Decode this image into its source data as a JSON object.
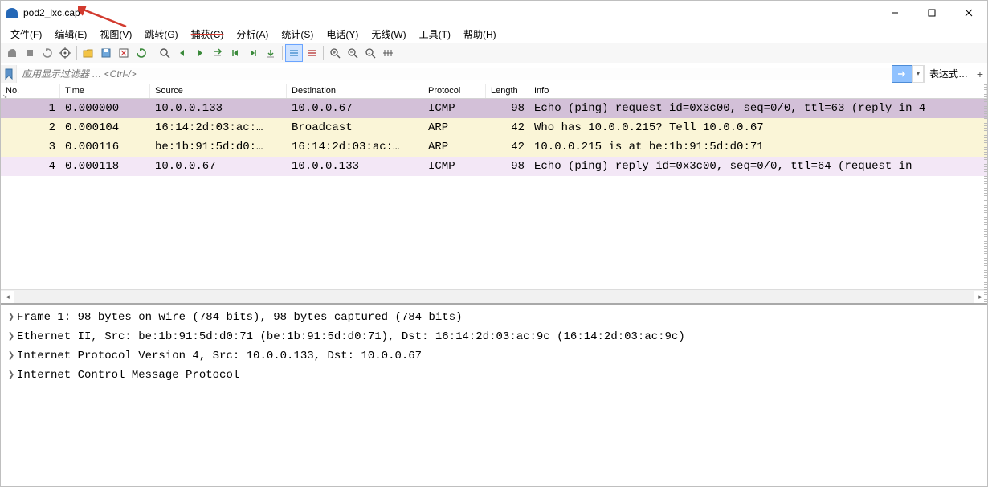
{
  "window": {
    "title": "pod2_lxc.cap"
  },
  "menu": {
    "items": [
      {
        "label": "文件(F)"
      },
      {
        "label": "编辑(E)"
      },
      {
        "label": "视图(V)"
      },
      {
        "label": "跳转(G)"
      },
      {
        "label": "捕获(C)",
        "strike": true
      },
      {
        "label": "分析(A)"
      },
      {
        "label": "统计(S)"
      },
      {
        "label": "电话(Y)"
      },
      {
        "label": "无线(W)"
      },
      {
        "label": "工具(T)"
      },
      {
        "label": "帮助(H)"
      }
    ]
  },
  "filter": {
    "placeholder": "应用显示过滤器 … <Ctrl-/>",
    "expression": "表达式…"
  },
  "columns": {
    "no": "No.",
    "time": "Time",
    "source": "Source",
    "destination": "Destination",
    "protocol": "Protocol",
    "length": "Length",
    "info": "Info"
  },
  "packets": [
    {
      "no": "1",
      "time": "0.000000",
      "source": "10.0.0.133",
      "destination": "10.0.0.67",
      "protocol": "ICMP",
      "length": "98",
      "info": "Echo (ping) request  id=0x3c00, seq=0/0, ttl=63 (reply in 4",
      "cls": "row-selected"
    },
    {
      "no": "2",
      "time": "0.000104",
      "source": "16:14:2d:03:ac:…",
      "destination": "Broadcast",
      "protocol": "ARP",
      "length": "42",
      "info": "Who has 10.0.0.215? Tell 10.0.0.67",
      "cls": "row-arp"
    },
    {
      "no": "3",
      "time": "0.000116",
      "source": "be:1b:91:5d:d0:…",
      "destination": "16:14:2d:03:ac:…",
      "protocol": "ARP",
      "length": "42",
      "info": "10.0.0.215 is at be:1b:91:5d:d0:71",
      "cls": "row-arp"
    },
    {
      "no": "4",
      "time": "0.000118",
      "source": "10.0.0.67",
      "destination": "10.0.0.133",
      "protocol": "ICMP",
      "length": "98",
      "info": "Echo (ping) reply    id=0x3c00, seq=0/0, ttl=64 (request in",
      "cls": "row-icmp-light"
    }
  ],
  "details": [
    "Frame 1: 98 bytes on wire (784 bits), 98 bytes captured (784 bits)",
    "Ethernet II, Src: be:1b:91:5d:d0:71 (be:1b:91:5d:d0:71), Dst: 16:14:2d:03:ac:9c (16:14:2d:03:ac:9c)",
    "Internet Protocol Version 4, Src: 10.0.0.133, Dst: 10.0.0.67",
    "Internet Control Message Protocol"
  ]
}
